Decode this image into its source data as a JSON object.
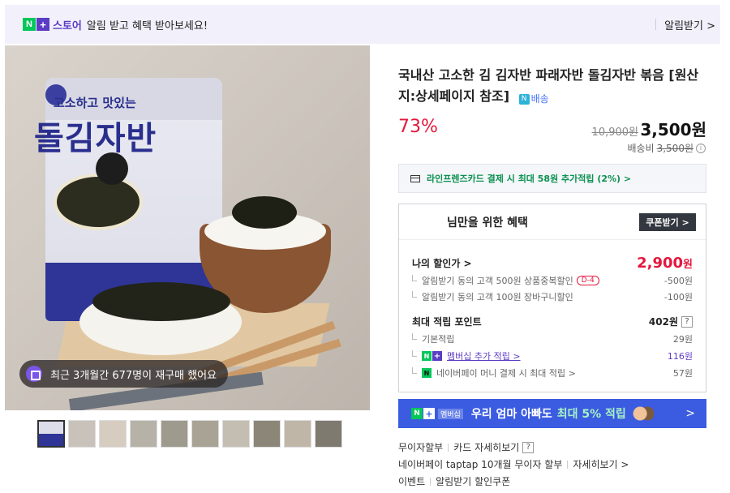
{
  "topbar": {
    "brand_n": "N",
    "brand_plus": "+",
    "brand_store": "스토어",
    "message": "알림 받고 혜택 받아보세요!",
    "alarm_link": "알림받기 >"
  },
  "gallery": {
    "pack_subtitle": "고소하고 맛있는",
    "pack_title": "돌김자반",
    "purchase_note": "최근 3개월간 677명이 재구매 했어요",
    "thumb_count": 10
  },
  "product": {
    "title": "국내산 고소한 김 김자반 파래자반 돌김자반 볶음 [원산지:상세페이지 참조]",
    "delivery_tag": "배송",
    "discount": "73%",
    "original_price": "10,900원",
    "sale_price": "3,500원",
    "shipping_label": "배송비",
    "shipping_fee": "3,500원"
  },
  "card_promo": "라인프렌즈카드 결제 시 최대 58원 추가적립 (2%) >",
  "benefit": {
    "title": "님만을 위한 혜택",
    "coupon_button": "쿠폰받기 >",
    "my_discount_label": "나의 할인가 >",
    "my_discount_value": "2,900",
    "won": "원",
    "rows": [
      {
        "label": "알림받기 동의 고객 500원 상품중복할인",
        "badge": "D-4",
        "value": "-500원"
      },
      {
        "label": "알림받기 동의 고객 100원 장바구니할인",
        "value": "-100원"
      }
    ],
    "points_label": "최대 적립 포인트",
    "points_value": "402원",
    "point_rows": [
      {
        "label": "기본적립",
        "value": "29원"
      },
      {
        "label": "멤버십 추가 적립 >",
        "value": "116원"
      },
      {
        "label": "네이버페이 머니 결제 시 최대 적립 >",
        "value": "57원"
      }
    ]
  },
  "banner": {
    "member_tag": "멤버십",
    "text": "우리 엄마 아빠도",
    "highlight": "최대 5% 적립",
    "chevron": ">"
  },
  "links": {
    "row1": [
      "무이자할부",
      "카드 자세히보기"
    ],
    "row2": [
      "네이버페이 taptap 10개월 무이자 할부",
      "자세히보기 >"
    ],
    "row3": [
      "이벤트",
      "알림받기 할인쿠폰"
    ]
  },
  "colors": {
    "accent_purple": "#5b3cc4",
    "naver_green": "#03c75a",
    "discount_red": "#e4173d",
    "banner_blue": "#3b5ce0"
  }
}
